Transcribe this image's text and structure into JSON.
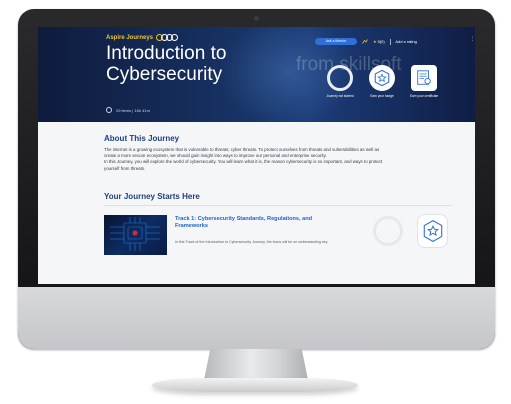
{
  "brand": {
    "name": "Aspire Journeys"
  },
  "hero": {
    "title_line1": "Introduction to",
    "title_line2": "Cybersecurity",
    "watermark": "from skillsoft",
    "meta": "29 items  |  16h 41m"
  },
  "toolbar": {
    "ask_mentor": "Ask a Mentor",
    "rating": "5(0)",
    "add_rating": "Add a rating",
    "more": "⋮"
  },
  "milestones": [
    {
      "label": "Journey not started"
    },
    {
      "label": "Earn your badge"
    },
    {
      "label": "Earn your certificate"
    }
  ],
  "about": {
    "heading": "About This Journey",
    "p1": "The internet is a growing ecosystem that is vulnerable to threats; cyber threats. To protect ourselves from threats and vulnerabilities as well as create a more secure ecosystem, we should gain insight into ways to improve our personal and enterprise security.",
    "p2": "In this Journey, you will explore the world of cybersecurity. You will learn what it is, the reason cybersecurity is so important, and ways to protect yourself from threats."
  },
  "journey": {
    "heading": "Your Journey Starts Here",
    "tracks": [
      {
        "title": "Track 1: Cybersecurity Standards, Regulations, and Frameworks",
        "description": "In this Track of the Introduction to Cybersecurity Journey, the focus will be on understanding key"
      }
    ]
  },
  "colors": {
    "hero_bg": "#173264",
    "brand_gold": "#f1c232",
    "heading_blue": "#1e3f7a",
    "link_blue": "#1f61c9",
    "mentor_button": "#2f6fd6"
  },
  "icons": [
    "info-icon",
    "share-icon",
    "star-icon",
    "more-icon",
    "badge-star-icon",
    "certificate-icon"
  ]
}
